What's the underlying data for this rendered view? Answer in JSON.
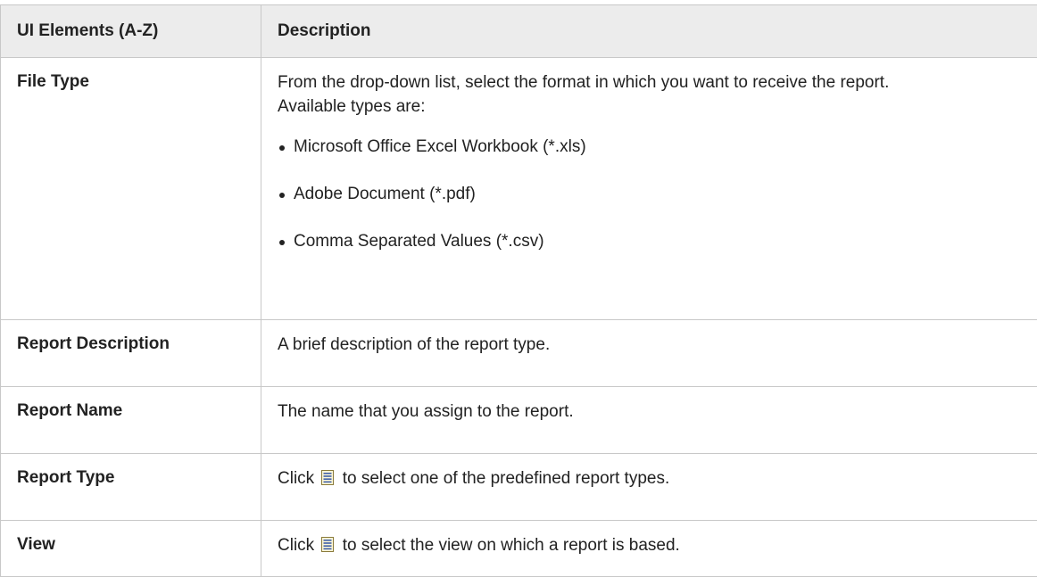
{
  "table": {
    "header": {
      "col1": "UI Elements (A-Z)",
      "col2": "Description"
    },
    "rows": [
      {
        "element": "File Type",
        "description": "From the drop-down list, select the format in which you want to receive the report.",
        "extra": "Available types are:",
        "types": [
          "Microsoft Office Excel Workbook (*.xls)",
          "Adobe Document (*.pdf)",
          "Comma Separated Values (*.csv)"
        ]
      },
      {
        "element": "Report Description",
        "description": "A brief description of the report type."
      },
      {
        "element": "Report Name",
        "description": "The name that you assign to the report."
      },
      {
        "element": "Report Type",
        "pre": "Click",
        "icon": "list-icon",
        "post": "to select one of the predefined report types."
      },
      {
        "element": "View",
        "pre": "Click",
        "icon": "list-icon",
        "post": "to select the view on which a report is based."
      }
    ]
  }
}
